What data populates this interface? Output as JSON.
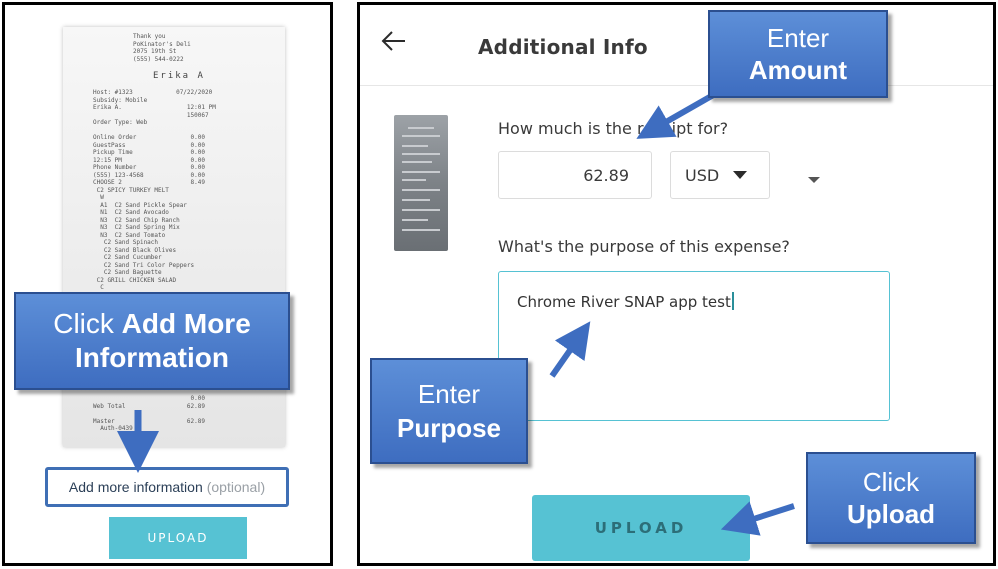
{
  "left": {
    "receipt": {
      "header": "Thank you\nPoKinator's Deli\n2075 19th St\n(555) 544-0222",
      "name": "Erika A",
      "body": "Host: #1323            07/22/2020\nSubsidy: Mobile\nErika A.                  12:01 PM\n                          150067\nOrder Type: Web\n\nOnline Order               0.00\nGuestPass                  0.00\nPickup Time                0.00\n12:15 PM                   0.00\nPhone Number               0.00\n(555) 123-4568             0.00\nCHOOSE 2                   8.49\n C2 SPICY TURKEY MELT\n  W\n  A1  C2 Sand Pickle Spear\n  N1  C2 Sand Avocado\n  N3  C2 Sand Chip Ranch\n  N3  C2 Sand Spring Mix\n  N3  C2 Sand Tomato\n   C2 Sand Spinach\n   C2 Sand Black Olives\n   C2 Sand Cucumber\n   C2 Sand Tri Color Peppers\n   C2 Sand Baguette\n C2 GRILL CHICKEN SALAD\n  C\n  A  C2 Cal Raspberry Vin\nCHOOSE 2                   8.49\n C2 FRENCH DIP             1.09\n  W  C2 Sand Pickle Spear",
      "foot": "                           0.00\nWeb Total                 62.89\n\nMaster                    62.89\n  Auth-0439"
    },
    "add_more_main": "Add more information",
    "add_more_optional": "(optional)",
    "upload_label": "UPLOAD"
  },
  "right": {
    "title": "Additional Info",
    "amount_question": "How much is the receipt for?",
    "amount_value": "62.89",
    "currency": "USD",
    "purpose_question": "What's the purpose of this expense?",
    "purpose_value": "Chrome River SNAP app test",
    "upload_label": "UPLOAD"
  },
  "callouts": {
    "add_more": {
      "line1_prefix": "Click ",
      "line1_bold": "Add More",
      "line2_bold": "Information"
    },
    "amount": {
      "line1": "Enter",
      "line2_bold": "Amount"
    },
    "purpose": {
      "line1": "Enter",
      "line2_bold": "Purpose"
    },
    "upload": {
      "line1": "Click",
      "line2_bold": "Upload"
    }
  },
  "colors": {
    "accent_teal": "#56c2d3",
    "callout_blue": "#4a7fcf",
    "callout_border": "#2b4f90"
  }
}
